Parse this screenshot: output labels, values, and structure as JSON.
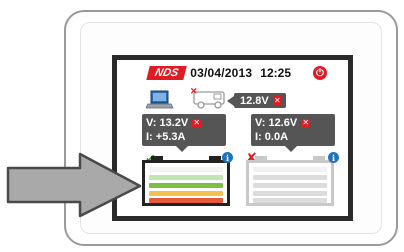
{
  "header": {
    "logo": "NDS",
    "date": "03/04/2013",
    "time": "12:25"
  },
  "icons": {
    "power": "power-icon",
    "laptop": "laptop-icon",
    "vehicle": "van-icon",
    "pointer": "arrow-pointer-icon"
  },
  "vehicle_voltage": "12.8V",
  "batteries": [
    {
      "voltage": "V: 13.2V",
      "current": "I:  +5.3A",
      "status": "ok",
      "charge_levels": [
        "#f3f3f3",
        "#bfe6b0",
        "#7bc043",
        "#f2c14e",
        "#e65a3c"
      ]
    },
    {
      "voltage": "V: 12.6V",
      "current": "I:     0.0A",
      "status": "error",
      "charge_levels": [
        "#f2f2f2",
        "#dcdcdc",
        "#dcdcdc",
        "#dcdcdc",
        "#dcdcdc"
      ]
    }
  ],
  "colors": {
    "brand_red": "#e11b22",
    "frame": "#2a2a2a",
    "readout_bg": "#555555",
    "info_blue": "#1e73be"
  }
}
